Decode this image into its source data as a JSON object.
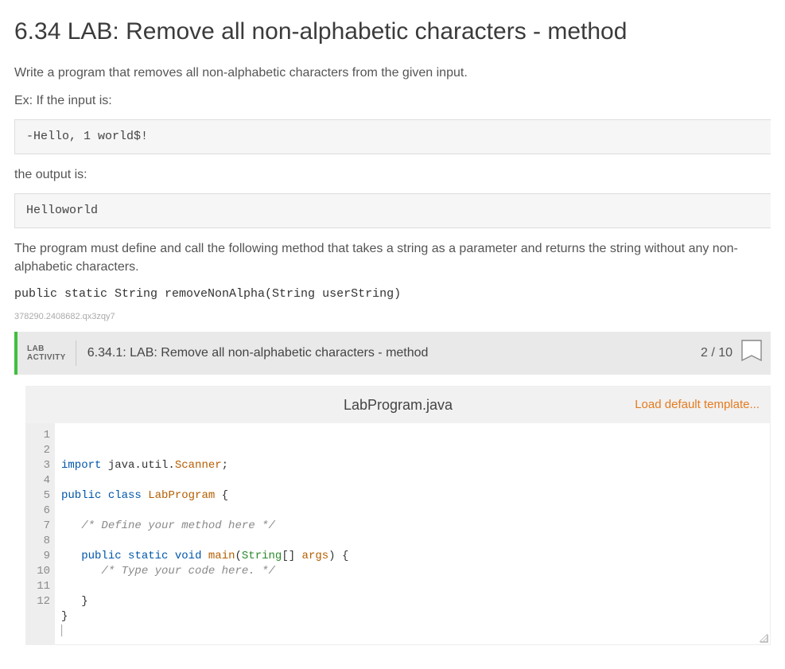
{
  "title": "6.34 LAB: Remove all non-alphabetic characters - method",
  "intro": "Write a program that removes all non-alphabetic characters from the given input.",
  "example_label": "Ex: If the input is:",
  "input_example": "-Hello, 1 world$!",
  "output_label": "the output is:",
  "output_example": "Helloworld",
  "must_define": "The program must define and call the following method that takes a string as a parameter and returns the string without any non-alphabetic characters.",
  "signature": "public static String removeNonAlpha(String userString)",
  "footprint": "378290.2408682.qx3zqy7",
  "activity": {
    "label_line1": "LAB",
    "label_line2": "ACTIVITY",
    "title": "6.34.1: LAB: Remove all non-alphabetic characters - method",
    "score": "2 / 10"
  },
  "editor": {
    "filename": "LabProgram.java",
    "load_link": "Load default template...",
    "line_count": 12,
    "code_tokens": [
      [
        {
          "c": "kw",
          "t": "import"
        },
        {
          "t": " java.util."
        },
        {
          "c": "ident",
          "t": "Scanner"
        },
        {
          "t": ";"
        }
      ],
      [],
      [
        {
          "c": "kw",
          "t": "public"
        },
        {
          "t": " "
        },
        {
          "c": "kw",
          "t": "class"
        },
        {
          "t": " "
        },
        {
          "c": "ident",
          "t": "LabProgram"
        },
        {
          "t": " {"
        }
      ],
      [],
      [
        {
          "t": "   "
        },
        {
          "c": "cmt",
          "t": "/* Define your method here */"
        }
      ],
      [],
      [
        {
          "t": "   "
        },
        {
          "c": "kw",
          "t": "public"
        },
        {
          "t": " "
        },
        {
          "c": "kw",
          "t": "static"
        },
        {
          "t": " "
        },
        {
          "c": "kw",
          "t": "void"
        },
        {
          "t": " "
        },
        {
          "c": "ident",
          "t": "main"
        },
        {
          "t": "("
        },
        {
          "c": "type",
          "t": "String"
        },
        {
          "t": "[] "
        },
        {
          "c": "ident",
          "t": "args"
        },
        {
          "t": ") {"
        }
      ],
      [
        {
          "t": "      "
        },
        {
          "c": "cmt",
          "t": "/* Type your code here. */"
        }
      ],
      [],
      [
        {
          "t": "   }"
        }
      ],
      [
        {
          "t": "}"
        }
      ],
      [
        {
          "cursor": true
        }
      ]
    ]
  }
}
